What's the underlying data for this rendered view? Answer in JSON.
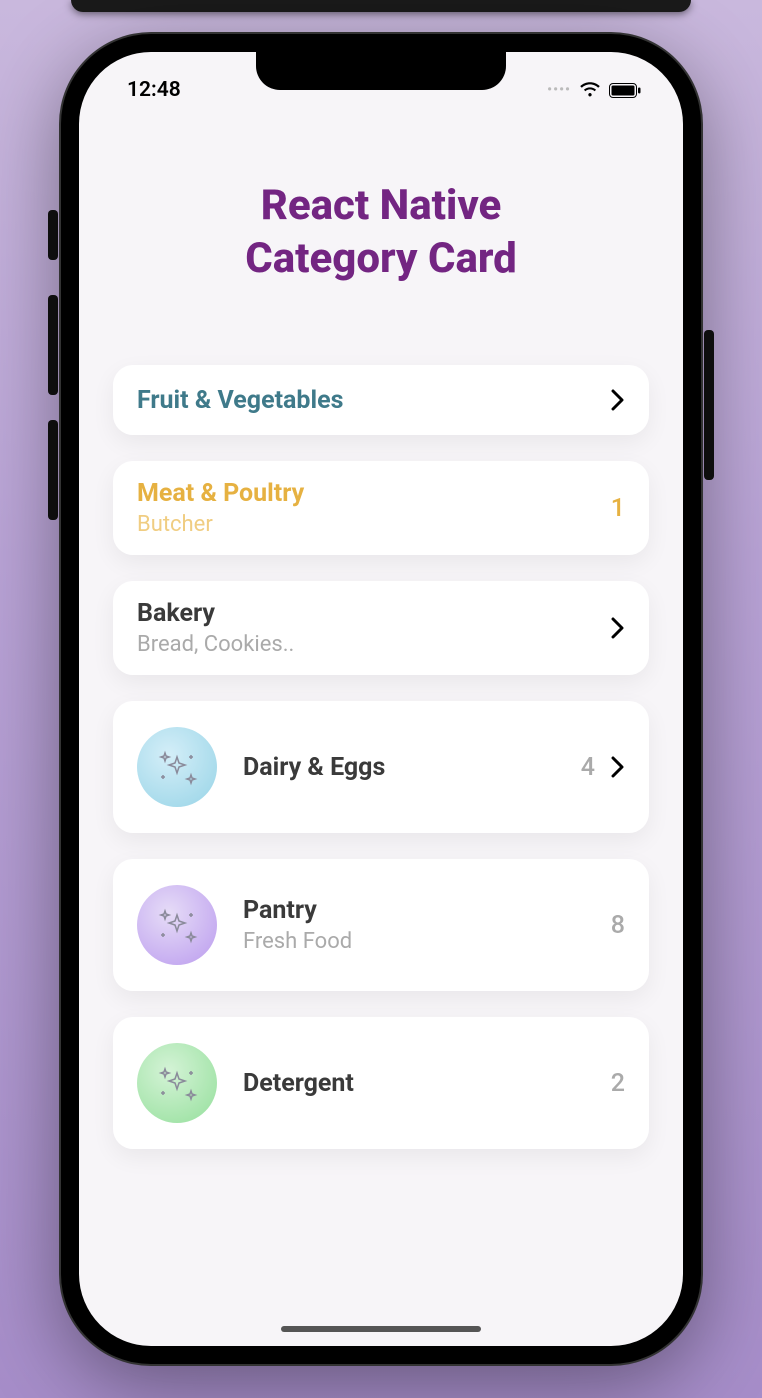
{
  "status": {
    "time": "12:48"
  },
  "page": {
    "title_line1": "React Native",
    "title_line2": "Category Card"
  },
  "cards": [
    {
      "title": "Fruit & Vegetables",
      "subtitle": null,
      "count": null,
      "chevron": true,
      "icon": null,
      "title_color": "teal"
    },
    {
      "title": "Meat & Poultry",
      "subtitle": "Butcher",
      "count": "1",
      "count_color": "gold",
      "chevron": false,
      "icon": null,
      "title_color": "gold",
      "sub_color": "gold"
    },
    {
      "title": "Bakery",
      "subtitle": "Bread, Cookies..",
      "count": null,
      "chevron": true,
      "icon": null
    },
    {
      "title": "Dairy & Eggs",
      "subtitle": null,
      "count": "4",
      "chevron": true,
      "icon": "blue"
    },
    {
      "title": "Pantry",
      "subtitle": "Fresh Food",
      "count": "8",
      "chevron": false,
      "icon": "purple"
    },
    {
      "title": "Detergent",
      "subtitle": null,
      "count": "2",
      "chevron": false,
      "icon": "green"
    }
  ]
}
